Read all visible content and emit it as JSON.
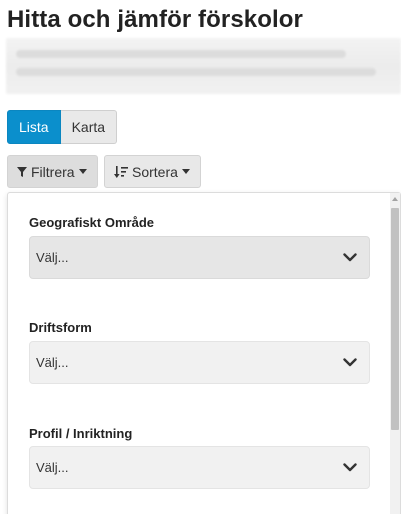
{
  "page": {
    "title": "Hitta och jämför förskolor"
  },
  "view_toggle": {
    "list_label": "Lista",
    "map_label": "Karta"
  },
  "toolbar": {
    "filter_label": "Filtrera",
    "sort_label": "Sortera"
  },
  "filters": [
    {
      "label": "Geografiskt Område",
      "placeholder": "Välj..."
    },
    {
      "label": "Driftsform",
      "placeholder": "Välj..."
    },
    {
      "label": "Profil / Inriktning",
      "placeholder": "Välj..."
    }
  ],
  "colors": {
    "accent": "#0b8fcc",
    "button_bg": "#e8e8e8"
  },
  "icons": [
    "funnel-icon",
    "sort-icon",
    "chevron-down-icon",
    "caret-down-icon"
  ]
}
